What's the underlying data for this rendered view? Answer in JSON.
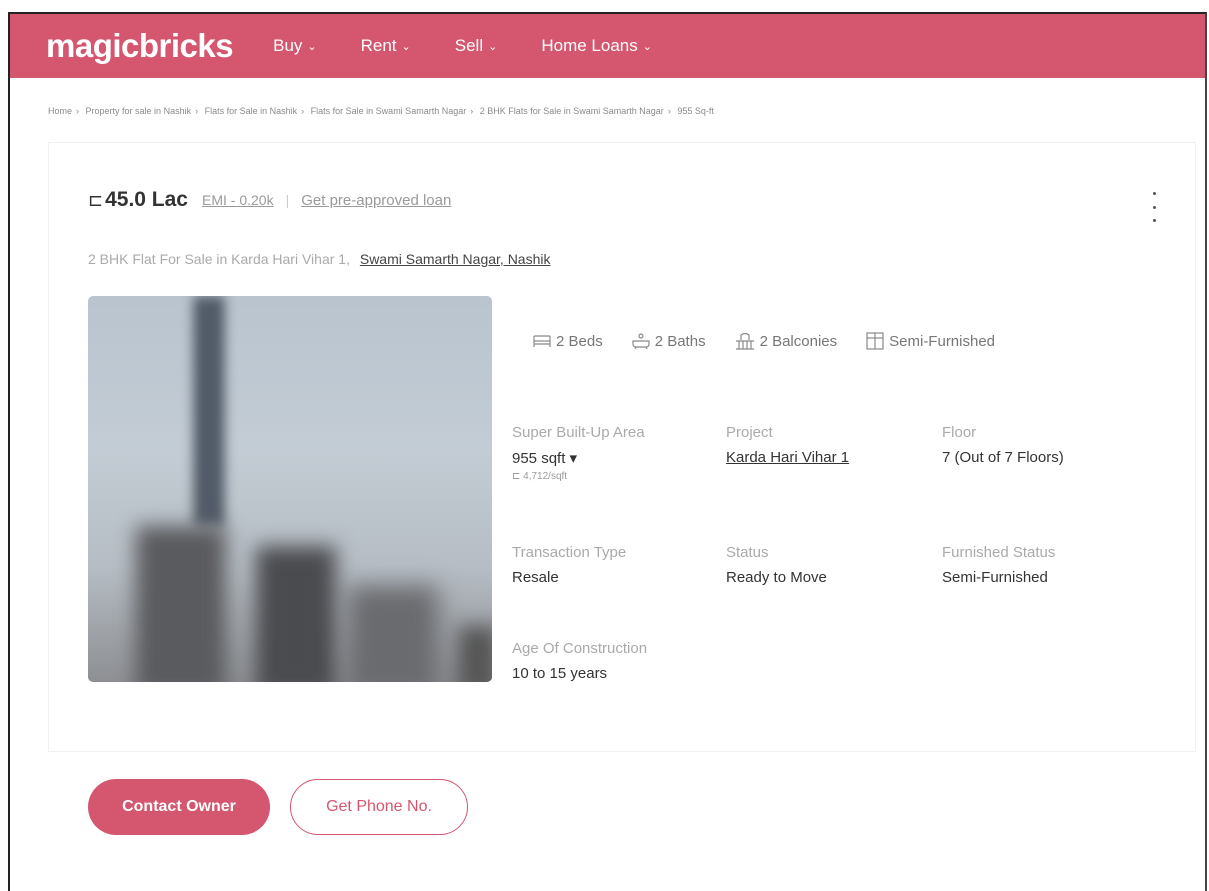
{
  "nav": {
    "logo": "magicbricks",
    "items": [
      {
        "label": "Buy"
      },
      {
        "label": "Rent"
      },
      {
        "label": "Sell"
      },
      {
        "label": "Home Loans"
      }
    ]
  },
  "breadcrumb": [
    "Home",
    "Property for sale in Nashik",
    "Flats for Sale in Nashik",
    "Flats for Sale in Swami Samarth Nagar",
    "2 BHK Flats for Sale in Swami Samarth Nagar",
    "955 Sq-ft"
  ],
  "listing": {
    "currency_symbol": "⊏",
    "price": "45.0 Lac",
    "emi": "EMI - 0.20k",
    "preapproved": "Get pre-approved loan",
    "title": "2 BHK Flat For Sale in Karda Hari Vihar 1,",
    "location": "Swami Samarth Nagar, Nashik",
    "amenities": [
      {
        "icon": "bed-icon",
        "label": "2 Beds"
      },
      {
        "icon": "bath-icon",
        "label": "2 Baths"
      },
      {
        "icon": "balcony-icon",
        "label": "2 Balconies"
      },
      {
        "icon": "furnish-icon",
        "label": "Semi-Furnished"
      }
    ],
    "details": {
      "area_label": "Super Built-Up Area",
      "area_value": "955 sqft ▾",
      "area_rate": "⊏ 4,712/sqft",
      "project_label": "Project",
      "project_value": "Karda Hari Vihar 1",
      "floor_label": "Floor",
      "floor_value": "7 (Out of 7 Floors)",
      "transaction_label": "Transaction Type",
      "transaction_value": "Resale",
      "status_label": "Status",
      "status_value": "Ready to Move",
      "furnished_label": "Furnished Status",
      "furnished_value": "Semi-Furnished",
      "age_label": "Age Of Construction",
      "age_value": "10 to 15 years"
    }
  },
  "actions": {
    "contact": "Contact Owner",
    "phone": "Get Phone No."
  },
  "colors": {
    "brand": "#d4566f"
  }
}
